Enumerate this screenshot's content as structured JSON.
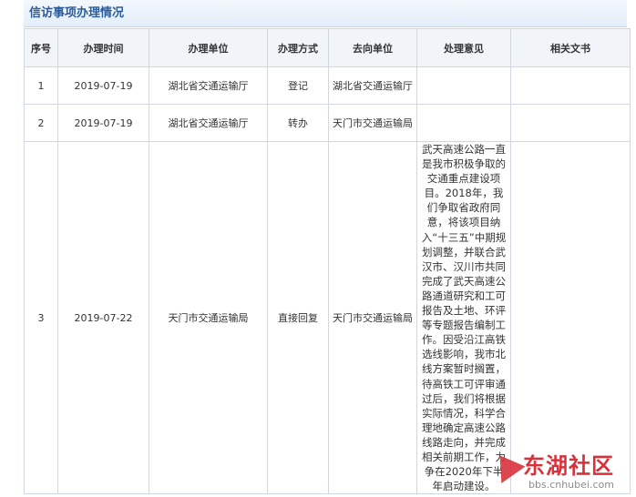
{
  "panel": {
    "title": "信访事项办理情况"
  },
  "table": {
    "headers": [
      "序号",
      "办理时间",
      "办理单位",
      "办理方式",
      "去向单位",
      "处理意见",
      "相关文书"
    ],
    "rows": [
      {
        "no": "1",
        "date": "2019-07-19",
        "unit": "湖北省交通运输厅",
        "method": "登记",
        "dest": "湖北省交通运输厅",
        "opinion": "",
        "doc": ""
      },
      {
        "no": "2",
        "date": "2019-07-19",
        "unit": "湖北省交通运输厅",
        "method": "转办",
        "dest": "天门市交通运输局",
        "opinion": "",
        "doc": ""
      },
      {
        "no": "3",
        "date": "2019-07-22",
        "unit": "天门市交通运输局",
        "method": "直接回复",
        "dest": "天门市交通运输局",
        "opinion": "武天高速公路一直\n是我市积极争取的\n交通重点建设项\n目。2018年，我\n们争取省政府同\n意，将该项目纳\n入“十三五”中期规\n划调整，并联合武\n汉市、汉川市共同\n完成了武天高速公\n路通道研究和工可\n报告及土地、环评\n等专题报告编制工\n作。因受沿江高铁\n选线影响，我市北\n线方案暂时搁置，\n待高铁工可评审通\n过后，我们将根据\n实际情况，科学合\n理地确定高速公路\n线路走向，并完成\n相关前期工作，力\n争在2020年下半\n年启动建设。",
        "doc": ""
      }
    ]
  },
  "watermark": {
    "brand": "东湖社区",
    "url": "bbs.cnhubei.com"
  }
}
